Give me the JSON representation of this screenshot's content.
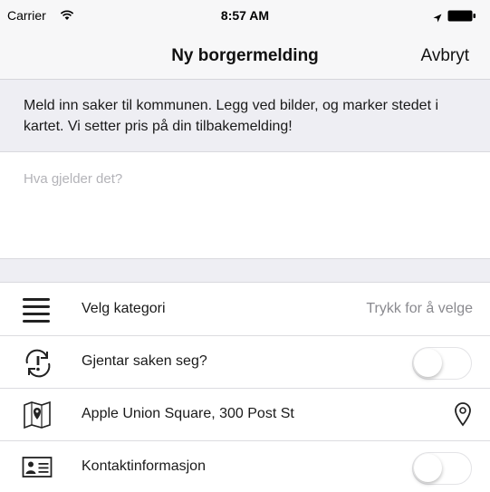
{
  "status_bar": {
    "carrier": "Carrier",
    "time": "8:57 AM"
  },
  "nav": {
    "title": "Ny borgermelding",
    "cancel_label": "Avbryt"
  },
  "info_text": "Meld inn saker til kommunen. Legg ved bilder, og marker stedet i kartet. Vi setter pris på din tilbakemelding!",
  "description_input": {
    "placeholder": "Hva gjelder det?",
    "value": ""
  },
  "rows": [
    {
      "label": "Velg kategori",
      "value": "Trykk for å velge",
      "icon": "list-lines-icon"
    },
    {
      "label": "Gjentar saken seg?",
      "icon": "recurring-alert-icon",
      "toggle_on": false
    },
    {
      "label": "Apple Union Square, 300 Post St",
      "icon": "map-icon",
      "action_icon": "location-pin-icon"
    },
    {
      "label": "Kontaktinformasjon",
      "icon": "contact-card-icon",
      "toggle_on": false
    }
  ]
}
